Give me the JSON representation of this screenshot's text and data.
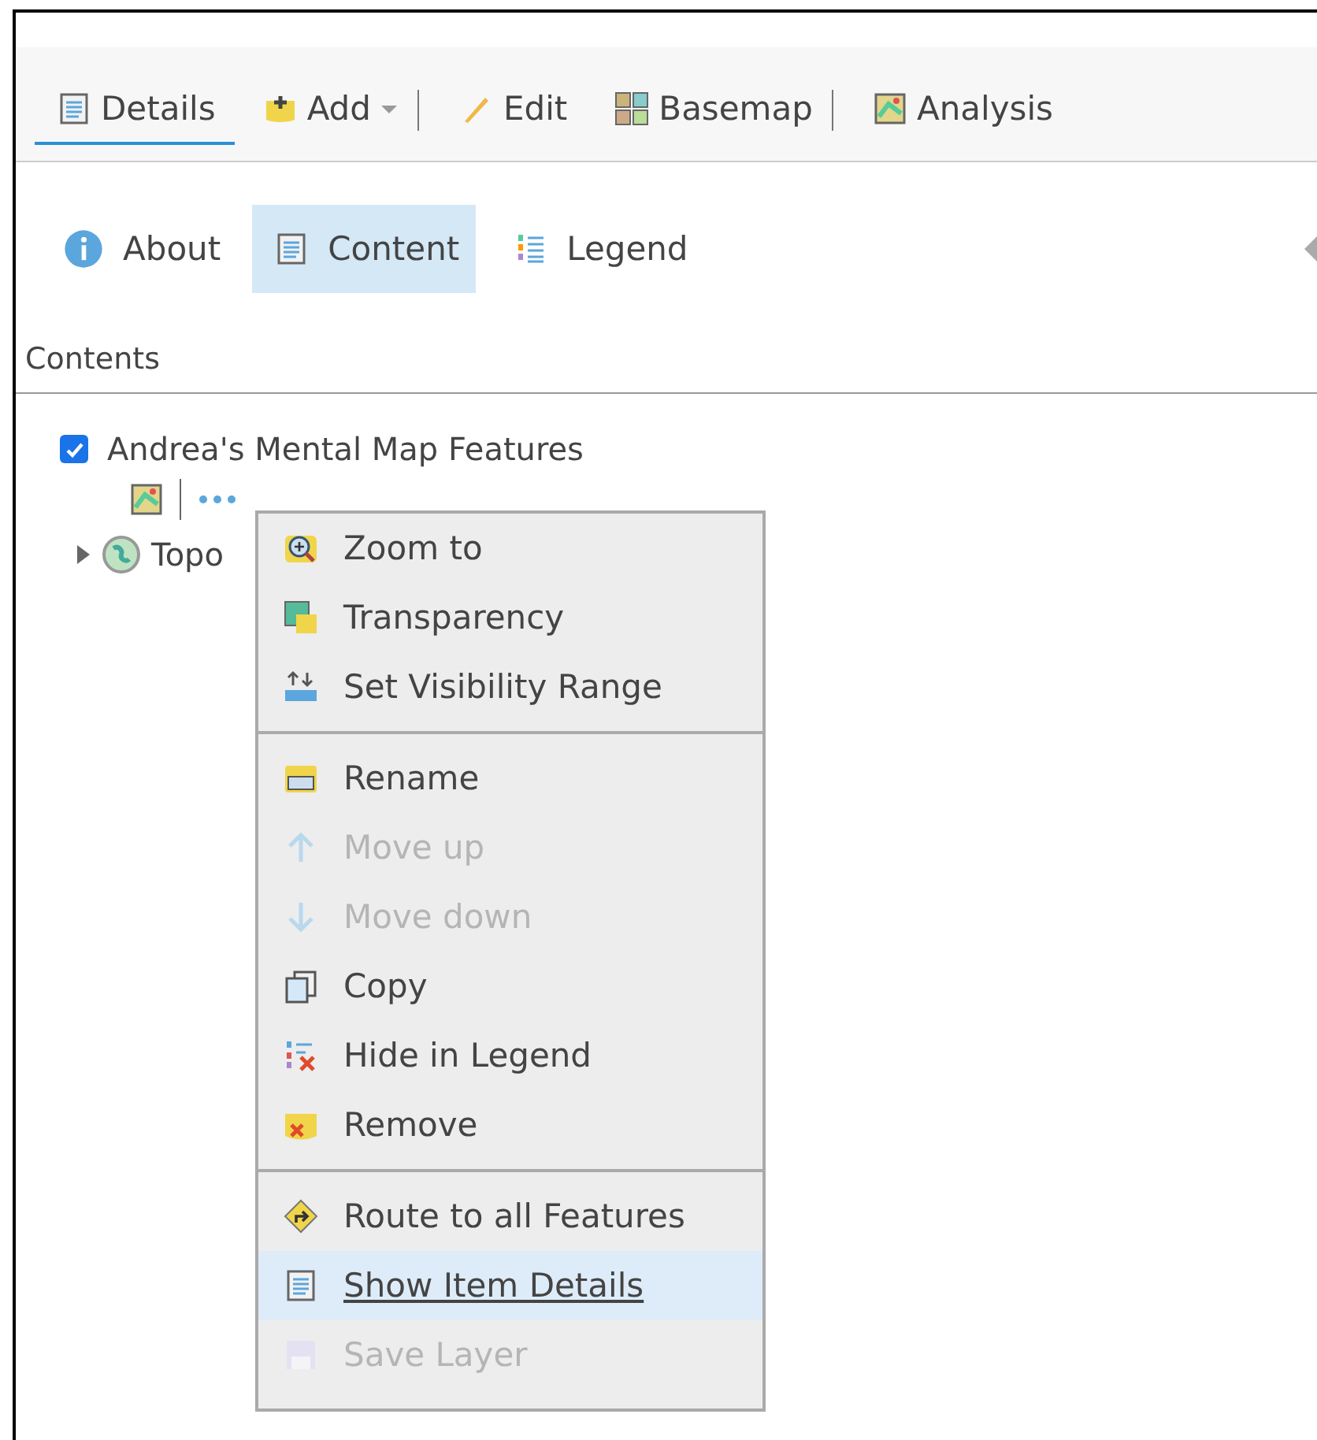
{
  "toolbar": {
    "tabs": [
      {
        "label": "Details",
        "selected": true,
        "dropdown": false,
        "divider_after": false
      },
      {
        "label": "Add",
        "selected": false,
        "dropdown": true,
        "divider_after": true
      },
      {
        "label": "Edit",
        "selected": false,
        "dropdown": false,
        "divider_after": false
      },
      {
        "label": "Basemap",
        "selected": false,
        "dropdown": false,
        "divider_after": true
      },
      {
        "label": "Analysis",
        "selected": false,
        "dropdown": false,
        "divider_after": false
      }
    ]
  },
  "subtabs": [
    {
      "label": "About",
      "selected": false
    },
    {
      "label": "Content",
      "selected": true
    },
    {
      "label": "Legend",
      "selected": false
    }
  ],
  "contents": {
    "title": "Contents",
    "layers": [
      {
        "name": "Andrea's Mental Map Features",
        "checked": true,
        "kind": "feature"
      },
      {
        "name": "Topo",
        "expanded": false,
        "kind": "basemap"
      }
    ]
  },
  "context_menu": {
    "sections": [
      [
        {
          "label": "Zoom to",
          "disabled": false,
          "selected": false
        },
        {
          "label": "Transparency",
          "disabled": false,
          "selected": false
        },
        {
          "label": "Set Visibility Range",
          "disabled": false,
          "selected": false
        }
      ],
      [
        {
          "label": "Rename",
          "disabled": false,
          "selected": false
        },
        {
          "label": "Move up",
          "disabled": true,
          "selected": false
        },
        {
          "label": "Move down",
          "disabled": true,
          "selected": false
        },
        {
          "label": "Copy",
          "disabled": false,
          "selected": false
        },
        {
          "label": "Hide in Legend",
          "disabled": false,
          "selected": false
        },
        {
          "label": "Remove",
          "disabled": false,
          "selected": false
        }
      ],
      [
        {
          "label": "Route to all Features",
          "disabled": false,
          "selected": false
        },
        {
          "label": "Show Item Details",
          "disabled": false,
          "selected": true
        },
        {
          "label": "Save Layer",
          "disabled": true,
          "selected": false
        }
      ]
    ]
  }
}
